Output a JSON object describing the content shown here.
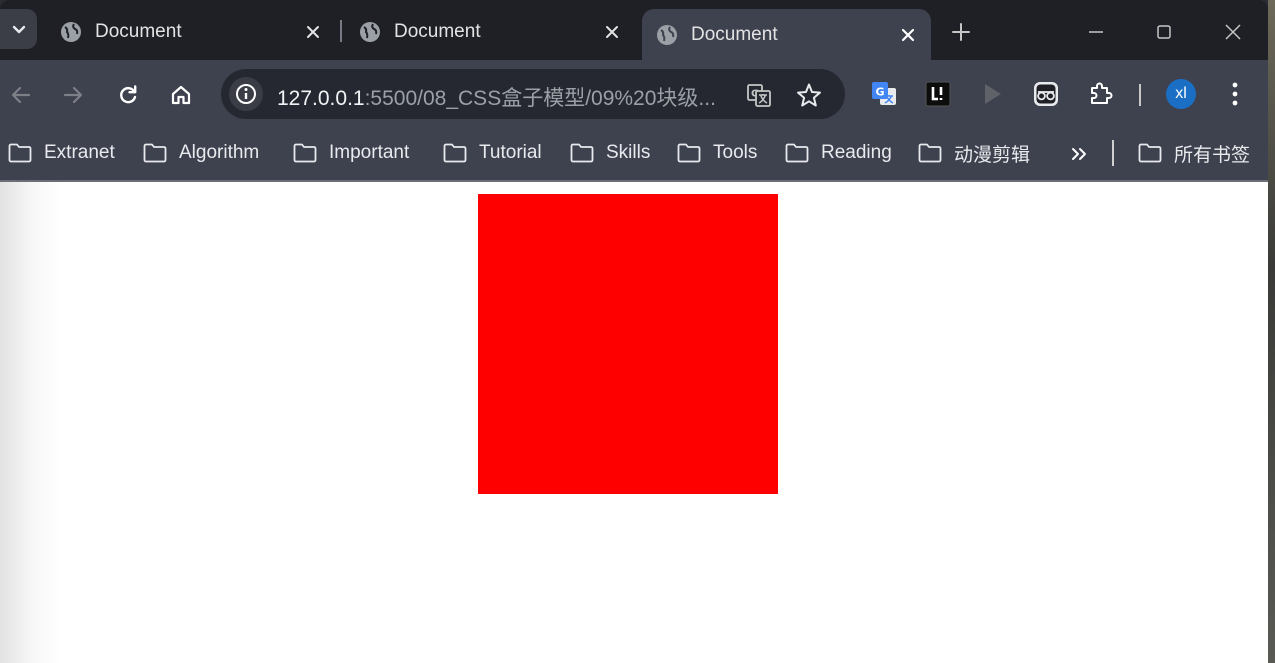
{
  "tabs": [
    {
      "title": "Document",
      "active": false
    },
    {
      "title": "Document",
      "active": false
    },
    {
      "title": "Document",
      "active": true
    }
  ],
  "address_bar": {
    "host": "127.0.0.1",
    "rest": ":5500/08_CSS盒子模型/09%20块级..."
  },
  "avatar": {
    "initials": "xl",
    "color": "#1a6fc4"
  },
  "bookmarks": {
    "items": [
      {
        "label": "Extranet"
      },
      {
        "label": "Algorithm"
      },
      {
        "label": "Important"
      },
      {
        "label": "Tutorial"
      },
      {
        "label": "Skills"
      },
      {
        "label": "Tools"
      },
      {
        "label": "Reading"
      },
      {
        "label": "动漫剪辑"
      }
    ],
    "all_bookmarks": "所有书签"
  },
  "page": {
    "box_color": "#ff0000"
  },
  "colors": {
    "tabstrip": "#1f2026",
    "toolbar": "#3e414e",
    "omnibox": "#262831",
    "page": "#ffffff"
  }
}
